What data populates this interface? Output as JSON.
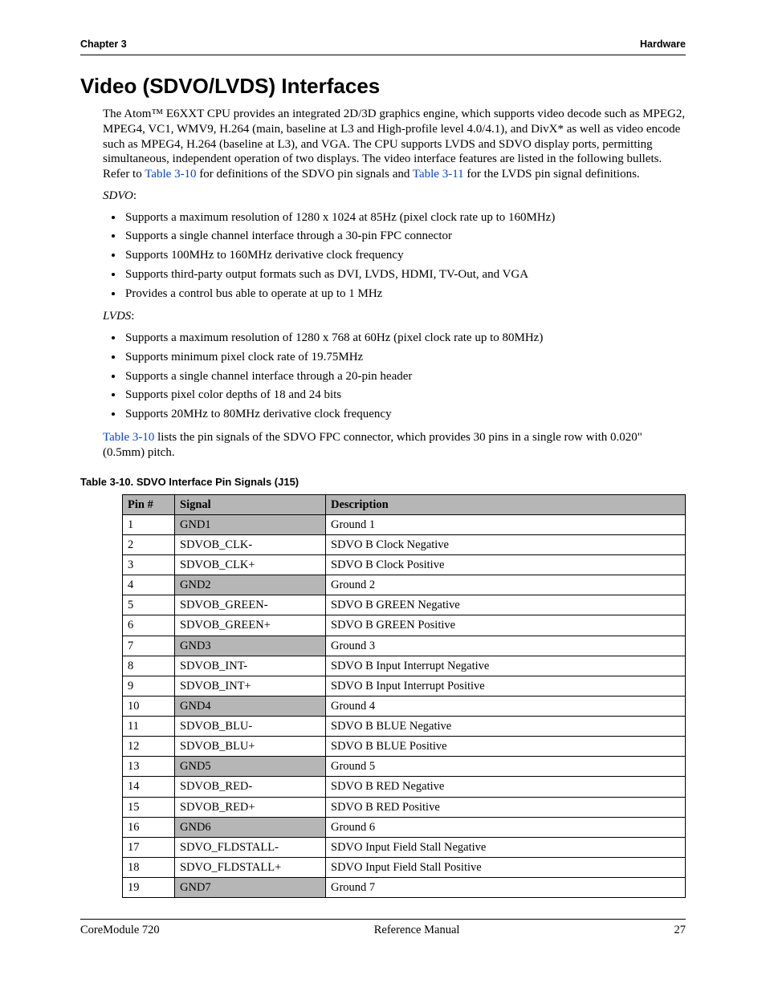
{
  "header": {
    "left": "Chapter 3",
    "right": "Hardware"
  },
  "title": "Video (SDVO/LVDS) Interfaces",
  "intro": {
    "p1a": "The Atom™ E6XXT CPU provides an integrated 2D/3D graphics engine, which supports video decode such as MPEG2, MPEG4, VC1, WMV9, H.264 (main, baseline at L3 and High-profile level 4.0/4.1), and DivX* as well as video encode such as MPEG4, H.264 (baseline at L3), and VGA. The CPU supports LVDS and SDVO display ports, permitting simultaneous, independent operation of two displays. The video interface features are listed in the following bullets. Refer to ",
    "link1": "Table 3-10",
    "p1b": " for definitions of the SDVO pin signals and ",
    "link2": "Table 3-11",
    "p1c": " for the LVDS pin signal definitions."
  },
  "sdvo": {
    "label": "SDVO",
    "bullets": [
      "Supports a maximum resolution of 1280 x 1024 at 85Hz (pixel clock rate up to 160MHz)",
      "Supports a single channel interface through a 30-pin FPC connector",
      "Supports 100MHz to 160MHz derivative clock frequency",
      "Supports third-party output formats such as DVI, LVDS, HDMI, TV-Out, and VGA",
      "Provides a control bus able to operate at up to 1 MHz"
    ]
  },
  "lvds": {
    "label": "LVDS",
    "bullets": [
      "Supports a maximum resolution of 1280 x 768 at 60Hz (pixel clock rate up to 80MHz)",
      "Supports minimum pixel clock rate of 19.75MHz",
      "Supports a single channel interface through a 20-pin header",
      "Supports pixel color depths of 18 and 24 bits",
      "Supports 20MHz to 80MHz derivative clock frequency"
    ]
  },
  "after_bullets": {
    "link": "Table 3-10",
    "tail": " lists the pin signals of the SDVO FPC connector, which provides 30 pins in a single row with 0.020\" (0.5mm) pitch."
  },
  "table": {
    "caption": "Table 3-10.   SDVO Interface Pin Signals (J15)",
    "headers": {
      "pin": "Pin #",
      "signal": "Signal",
      "desc": "Description"
    },
    "rows": [
      {
        "pin": "1",
        "signal": "GND1",
        "desc": "Ground 1",
        "gnd": true
      },
      {
        "pin": "2",
        "signal": "SDVOB_CLK-",
        "desc": "SDVO B Clock Negative",
        "gnd": false
      },
      {
        "pin": "3",
        "signal": "SDVOB_CLK+",
        "desc": "SDVO B Clock Positive",
        "gnd": false
      },
      {
        "pin": "4",
        "signal": "GND2",
        "desc": "Ground 2",
        "gnd": true
      },
      {
        "pin": "5",
        "signal": "SDVOB_GREEN-",
        "desc": "SDVO B GREEN Negative",
        "gnd": false
      },
      {
        "pin": "6",
        "signal": "SDVOB_GREEN+",
        "desc": "SDVO B GREEN Positive",
        "gnd": false
      },
      {
        "pin": "7",
        "signal": "GND3",
        "desc": "Ground 3",
        "gnd": true
      },
      {
        "pin": "8",
        "signal": "SDVOB_INT-",
        "desc": "SDVO B Input Interrupt Negative",
        "gnd": false
      },
      {
        "pin": "9",
        "signal": "SDVOB_INT+",
        "desc": "SDVO B Input Interrupt Positive",
        "gnd": false
      },
      {
        "pin": "10",
        "signal": "GND4",
        "desc": "Ground 4",
        "gnd": true
      },
      {
        "pin": "11",
        "signal": "SDVOB_BLU-",
        "desc": "SDVO B BLUE Negative",
        "gnd": false
      },
      {
        "pin": "12",
        "signal": "SDVOB_BLU+",
        "desc": "SDVO B BLUE Positive",
        "gnd": false
      },
      {
        "pin": "13",
        "signal": "GND5",
        "desc": "Ground 5",
        "gnd": true
      },
      {
        "pin": "14",
        "signal": "SDVOB_RED-",
        "desc": "SDVO B RED Negative",
        "gnd": false
      },
      {
        "pin": "15",
        "signal": "SDVOB_RED+",
        "desc": "SDVO B RED Positive",
        "gnd": false
      },
      {
        "pin": "16",
        "signal": "GND6",
        "desc": "Ground 6",
        "gnd": true
      },
      {
        "pin": "17",
        "signal": "SDVO_FLDSTALL-",
        "desc": "SDVO Input Field Stall Negative",
        "gnd": false
      },
      {
        "pin": "18",
        "signal": "SDVO_FLDSTALL+",
        "desc": "SDVO Input Field Stall Positive",
        "gnd": false
      },
      {
        "pin": "19",
        "signal": "GND7",
        "desc": "Ground 7",
        "gnd": true
      }
    ]
  },
  "footer": {
    "left": "CoreModule 720",
    "center": "Reference Manual",
    "right": "27"
  }
}
